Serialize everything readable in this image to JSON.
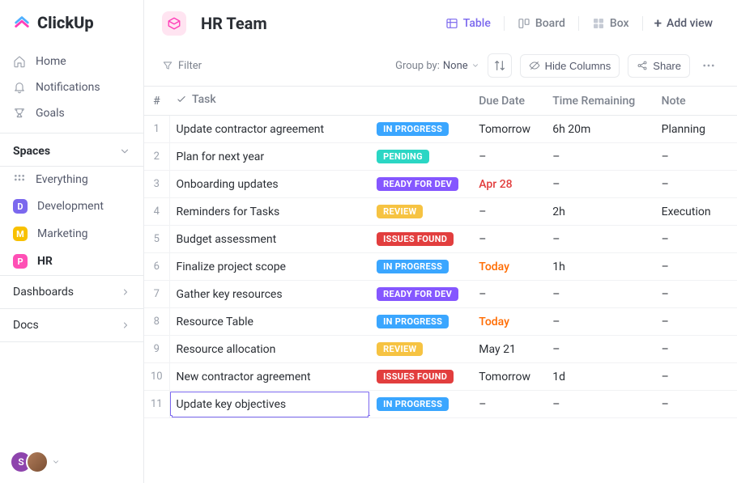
{
  "logo_text": "ClickUp",
  "nav": [
    {
      "label": "Home",
      "icon": "home-icon"
    },
    {
      "label": "Notifications",
      "icon": "bell-icon"
    },
    {
      "label": "Goals",
      "icon": "trophy-icon"
    }
  ],
  "spaces_header": "Spaces",
  "everything_label": "Everything",
  "spaces": [
    {
      "label": "Development",
      "initial": "D",
      "color": "#7b68ee"
    },
    {
      "label": "Marketing",
      "initial": "M",
      "color": "#f8c100"
    },
    {
      "label": "HR",
      "initial": "P",
      "color": "#ff4fb5",
      "bold": true
    }
  ],
  "dashboards_label": "Dashboards",
  "docs_label": "Docs",
  "avatar_initial": "S",
  "space_title": "HR Team",
  "views": {
    "table": "Table",
    "board": "Board",
    "box": "Box",
    "add": "Add view"
  },
  "toolbar": {
    "filter": "Filter",
    "groupby_label": "Group by:",
    "groupby_value": "None",
    "hide_columns": "Hide Columns",
    "share": "Share"
  },
  "columns": {
    "num": "#",
    "task": "Task",
    "status": "",
    "due": "Due Date",
    "time": "Time Remaining",
    "note": "Note"
  },
  "status_colors": {
    "IN PROGRESS": "#3aa6ff",
    "PENDING": "#2bd6c4",
    "READY FOR DEV": "#8557ff",
    "REVIEW": "#f6c342",
    "ISSUES FOUND": "#e23e3e"
  },
  "rows": [
    {
      "num": "1",
      "task": "Update contractor agreement",
      "status": "IN PROGRESS",
      "due": "Tomorrow",
      "due_class": "",
      "time": "6h 20m",
      "note": "Planning"
    },
    {
      "num": "2",
      "task": "Plan for next year",
      "status": "PENDING",
      "due": "–",
      "due_class": "",
      "time": "–",
      "note": "–"
    },
    {
      "num": "3",
      "task": "Onboarding updates",
      "status": "READY FOR DEV",
      "due": "Apr 28",
      "due_class": "due-red",
      "time": "–",
      "note": "–"
    },
    {
      "num": "4",
      "task": "Reminders for Tasks",
      "status": "REVIEW",
      "due": "–",
      "due_class": "",
      "time": "2h",
      "note": "Execution"
    },
    {
      "num": "5",
      "task": "Budget assessment",
      "status": "ISSUES FOUND",
      "due": "–",
      "due_class": "",
      "time": "–",
      "note": "–"
    },
    {
      "num": "6",
      "task": "Finalize project scope",
      "status": "IN PROGRESS",
      "due": "Today",
      "due_class": "due-today",
      "time": "1h",
      "note": "–"
    },
    {
      "num": "7",
      "task": "Gather key resources",
      "status": "READY FOR DEV",
      "due": "–",
      "due_class": "",
      "time": "–",
      "note": "–"
    },
    {
      "num": "8",
      "task": "Resource Table",
      "status": "IN PROGRESS",
      "due": "Today",
      "due_class": "due-today",
      "time": "–",
      "note": "–"
    },
    {
      "num": "9",
      "task": "Resource allocation",
      "status": "REVIEW",
      "due": "May 21",
      "due_class": "",
      "time": "–",
      "note": "–"
    },
    {
      "num": "10",
      "task": "New contractor agreement",
      "status": "ISSUES FOUND",
      "due": "Tomorrow",
      "due_class": "",
      "time": "1d",
      "note": "–"
    },
    {
      "num": "11",
      "task": "Update key objectives",
      "status": "IN PROGRESS",
      "due": "–",
      "due_class": "",
      "time": "–",
      "note": "–",
      "selected": true
    }
  ]
}
